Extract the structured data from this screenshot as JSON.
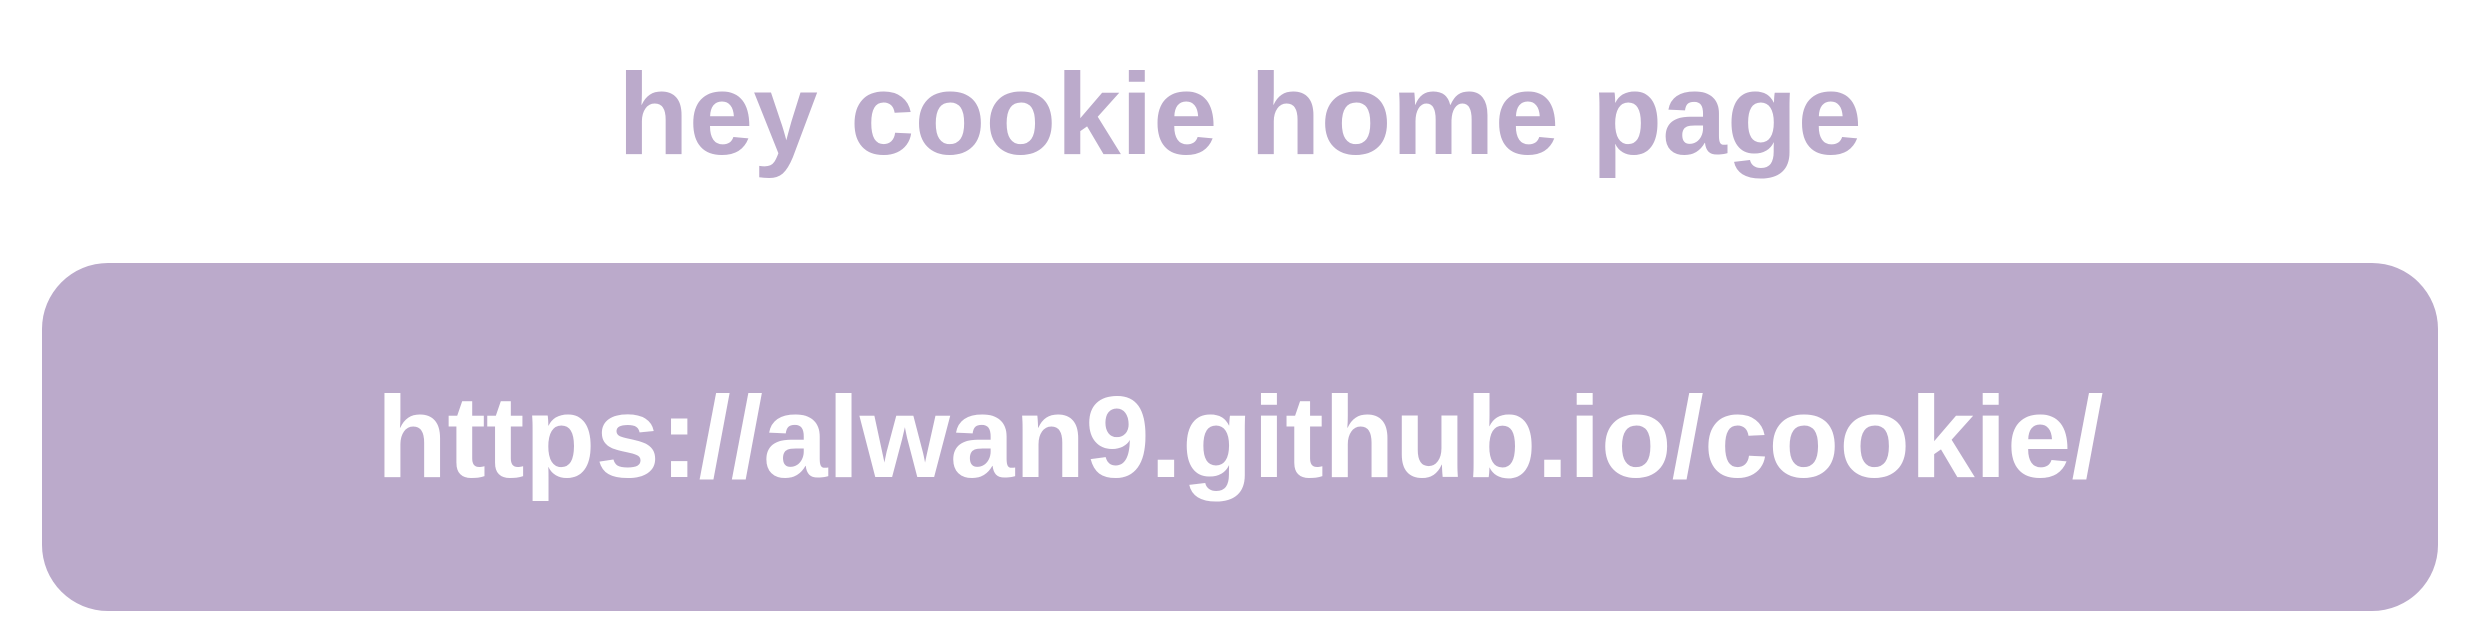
{
  "title": "hey cookie home page",
  "link": {
    "url": "https://alwan9.github.io/cookie/"
  },
  "colors": {
    "accent": "#bbaacb",
    "link_text": "#ffffff",
    "background": "#ffffff"
  }
}
